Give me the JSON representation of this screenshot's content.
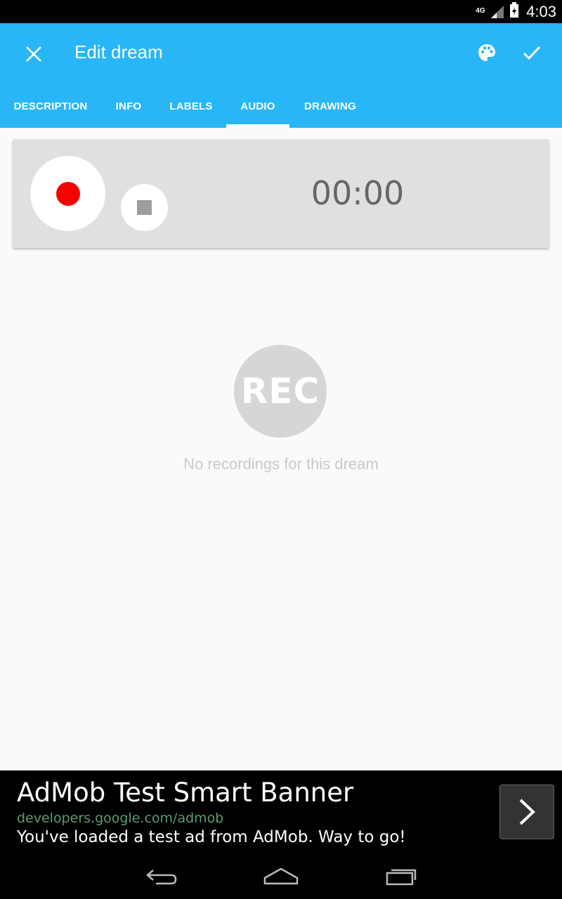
{
  "status_bar": {
    "network": "4G",
    "time": "4:03"
  },
  "toolbar": {
    "title": "Edit dream",
    "background_color": "#29B6F6"
  },
  "tabs": [
    {
      "label": "DESCRIPTION",
      "selected": false
    },
    {
      "label": "INFO",
      "selected": false
    },
    {
      "label": "LABELS",
      "selected": false
    },
    {
      "label": "AUDIO",
      "selected": true
    },
    {
      "label": "DRAWING",
      "selected": false
    }
  ],
  "recorder": {
    "timer": "00:00",
    "record_color": "#F60000"
  },
  "empty_state": {
    "icon_text": "REC",
    "message": "No recordings for this dream"
  },
  "ad": {
    "title": "AdMob Test Smart Banner",
    "url": "developers.google.com/admob",
    "body": "You've loaded a test ad from AdMob. Way to go!"
  },
  "icons": {
    "close": "close-icon",
    "palette": "palette-icon",
    "check": "check-icon",
    "record": "record-icon",
    "stop": "stop-icon",
    "ad_arrow": "chevron-right-icon",
    "back": "back-icon",
    "home": "home-icon",
    "recents": "recents-icon"
  }
}
